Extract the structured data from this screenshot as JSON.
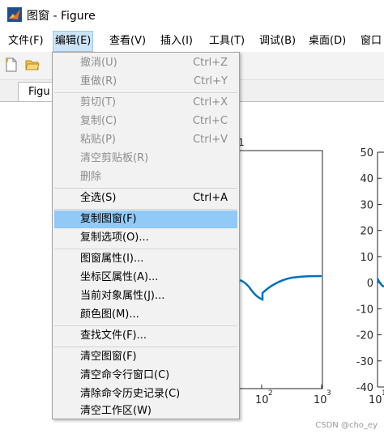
{
  "window": {
    "title": "图窗 - Figure"
  },
  "menubar": {
    "items": [
      "文件(F)",
      "编辑(E)",
      "查看(V)",
      "插入(I)",
      "工具(T)",
      "调试(B)",
      "桌面(D)",
      "窗口"
    ],
    "active": "编辑(E)"
  },
  "tab": {
    "label": "Figu"
  },
  "edit_menu": {
    "undo": {
      "label": "撤消(U)",
      "shortcut": "Ctrl+Z"
    },
    "redo": {
      "label": "重做(R)",
      "shortcut": "Ctrl+Y"
    },
    "cut": {
      "label": "剪切(T)",
      "shortcut": "Ctrl+X"
    },
    "copy": {
      "label": "复制(C)",
      "shortcut": "Ctrl+C"
    },
    "paste": {
      "label": "粘贴(P)",
      "shortcut": "Ctrl+V"
    },
    "clear_clipboard": {
      "label": "清空剪贴板(R)"
    },
    "delete": {
      "label": "删除"
    },
    "select_all": {
      "label": "全选(S)",
      "shortcut": "Ctrl+A"
    },
    "copy_figure": {
      "label": "复制图窗(F)"
    },
    "copy_options": {
      "label": "复制选项(O)..."
    },
    "figure_properties": {
      "label": "图窗属性(I)..."
    },
    "axes_properties": {
      "label": "坐标区属性(A)..."
    },
    "current_object_properties": {
      "label": "当前对象属性(J)..."
    },
    "colormap": {
      "label": "颜色图(M)..."
    },
    "find_files": {
      "label": "查找文件(F)..."
    },
    "clear_figure": {
      "label": "清空图窗(F)"
    },
    "clear_command_window": {
      "label": "清空命令行窗口(C)"
    },
    "clear_command_history": {
      "label": "清除命令历史记录(C)"
    },
    "clear_workspace": {
      "label": "清空工作区(W)"
    }
  },
  "left_axes": {
    "title_fragment": "1",
    "x_ticks": [
      {
        "base": "10",
        "exp": "2"
      },
      {
        "base": "10",
        "exp": "3"
      }
    ]
  },
  "right_axes": {
    "y_ticks": [
      "50",
      "40",
      "30",
      "20",
      "10",
      "0",
      "-10",
      "-20",
      "-30",
      "-40"
    ],
    "x_tick": {
      "base": "10",
      "exp": "1"
    }
  },
  "watermark": "CSDN @cho_ey",
  "colors": {
    "line": "#0072bd",
    "highlight": "#91c9f7",
    "menu_active": "#cce4f7"
  }
}
